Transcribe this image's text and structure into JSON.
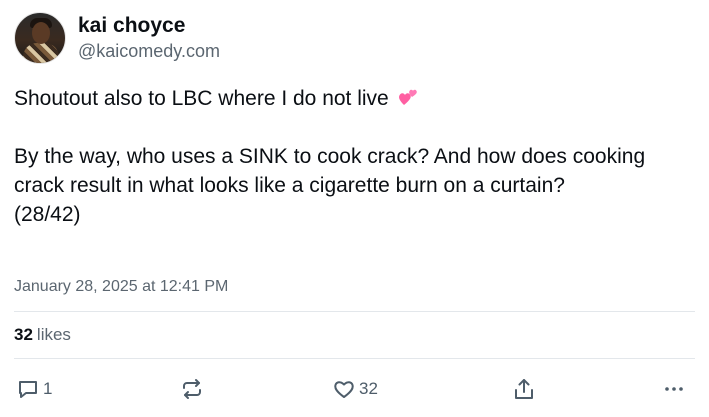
{
  "post": {
    "author": {
      "display_name": "kai choyce",
      "handle": "@kaicomedy.com"
    },
    "text": {
      "line1": "Shoutout also to LBC where I do not live",
      "line1_emoji": "two-hearts-emoji",
      "paragraph2": "By the way, who uses a SINK to cook crack? And how does cooking crack result in what looks like a cigarette burn on a curtain?",
      "counter": "(28/42)"
    },
    "timestamp": "January 28, 2025 at 12:41 PM",
    "stats": {
      "likes_count": "32",
      "likes_label": "likes"
    },
    "actions": {
      "reply_count": "1",
      "like_count": "32",
      "icons": [
        "reply-icon",
        "repost-icon",
        "like-icon",
        "share-icon",
        "more-icon"
      ]
    }
  },
  "colors": {
    "text": "#0b0f14",
    "muted": "#5b6670",
    "divider": "#e3e7eb",
    "heart_emoji": "#ff5fa2"
  }
}
